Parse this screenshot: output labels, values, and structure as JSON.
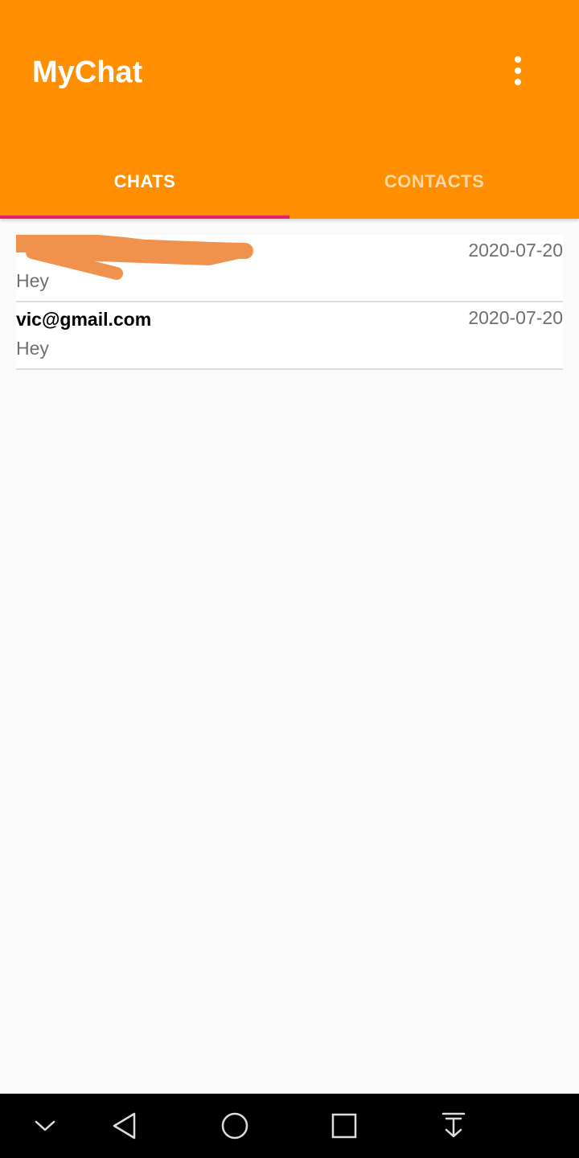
{
  "app": {
    "title": "MyChat",
    "accent": "#ff8f00",
    "indicator_color": "#e91e63",
    "overflow_icon": "more-vert-icon"
  },
  "tabs": [
    {
      "label": "CHATS",
      "selected": true
    },
    {
      "label": "CONTACTS",
      "selected": false
    }
  ],
  "chats": [
    {
      "name": "",
      "redacted": true,
      "date": "2020-07-20",
      "message": "Hey"
    },
    {
      "name": "vic@gmail.com",
      "redacted": false,
      "date": "2020-07-20",
      "message": "Hey"
    }
  ],
  "navbar": {
    "icons": [
      "chevron-down-icon",
      "back-icon",
      "home-icon",
      "recents-icon",
      "notification-pull-icon"
    ]
  }
}
